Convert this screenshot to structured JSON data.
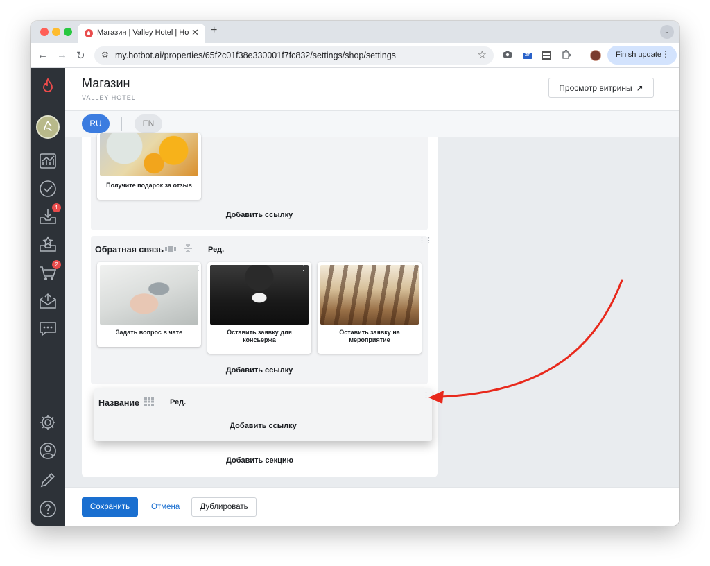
{
  "browser": {
    "tab_title": "Магазин | Valley Hotel | Hotbot",
    "url": "my.hotbot.ai/properties/65f2c01f38e330001f7fc832/settings/shop/settings",
    "finish_update_label": "Finish update",
    "zip_label": "ZIP"
  },
  "sidebar": {
    "badges": {
      "inbox": "1",
      "cart": "2"
    }
  },
  "header": {
    "title": "Магазин",
    "subtitle": "VALLEY HOTEL",
    "preview_button": "Просмотр витрины"
  },
  "languages": {
    "ru": "RU",
    "en": "EN"
  },
  "sections": [
    {
      "cards": [
        {
          "label": "Получите подарок за отзыв"
        }
      ],
      "add_link": "Добавить ссылку"
    },
    {
      "title": "Обратная связь",
      "edit": "Ред.",
      "cards": [
        {
          "label": "Задать вопрос в чате"
        },
        {
          "label": "Оставить заявку для консьержа"
        },
        {
          "label": "Оставить заявку на мероприятие"
        }
      ],
      "add_link": "Добавить ссылку"
    },
    {
      "title": "Название",
      "edit": "Ред.",
      "add_link": "Добавить ссылку"
    }
  ],
  "add_section": "Добавить секцию",
  "footer": {
    "save": "Сохранить",
    "cancel": "Отмена",
    "duplicate": "Дублировать"
  },
  "colors": {
    "accent": "#1a6fd0",
    "sidebar_bg": "#2d3238",
    "badge": "#e94c4c",
    "annotation_arrow": "#e8291c"
  }
}
